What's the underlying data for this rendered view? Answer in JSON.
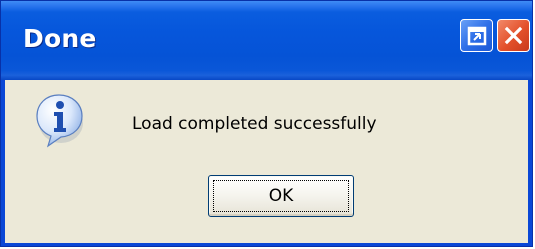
{
  "window": {
    "title": "Done",
    "controls": [
      {
        "name": "restore-icon",
        "color": "#2e6fe8"
      },
      {
        "name": "close-icon",
        "color": "#e3502a"
      }
    ]
  },
  "dialog": {
    "icon": "information-icon",
    "message": "Load completed successfully",
    "ok_label": "OK"
  },
  "colors": {
    "titlebar": "#0656db",
    "client_background": "#ece9d8",
    "title_text": "#ffffff"
  }
}
